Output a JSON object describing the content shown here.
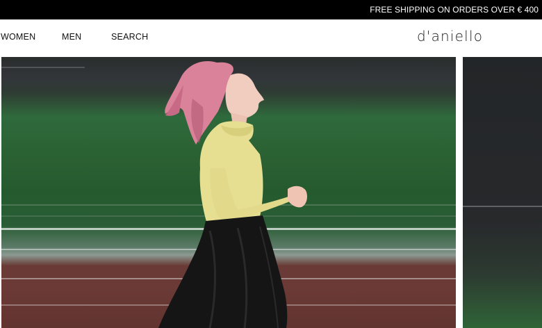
{
  "announcement": {
    "text": "FREE SHIPPING ON ORDERS OVER € 400"
  },
  "nav": {
    "items": [
      {
        "label": "WOMEN"
      },
      {
        "label": "MEN"
      },
      {
        "label": "SEARCH"
      }
    ]
  },
  "brand": {
    "logo_text": "d'aniello"
  },
  "colors": {
    "announcement_bg": "#000000",
    "announcement_text": "#ffffff",
    "header_bg": "#ffffff",
    "field_green": "#2b6233",
    "track_red": "#6b3a36",
    "top_yellow": "#e6df92",
    "skirt_black": "#151515",
    "hair_pink": "#d9829a"
  },
  "hero": {
    "image_alt": "Woman running on a track wearing a yellow top and black leather skirt",
    "secondary_panel_alt": ""
  }
}
